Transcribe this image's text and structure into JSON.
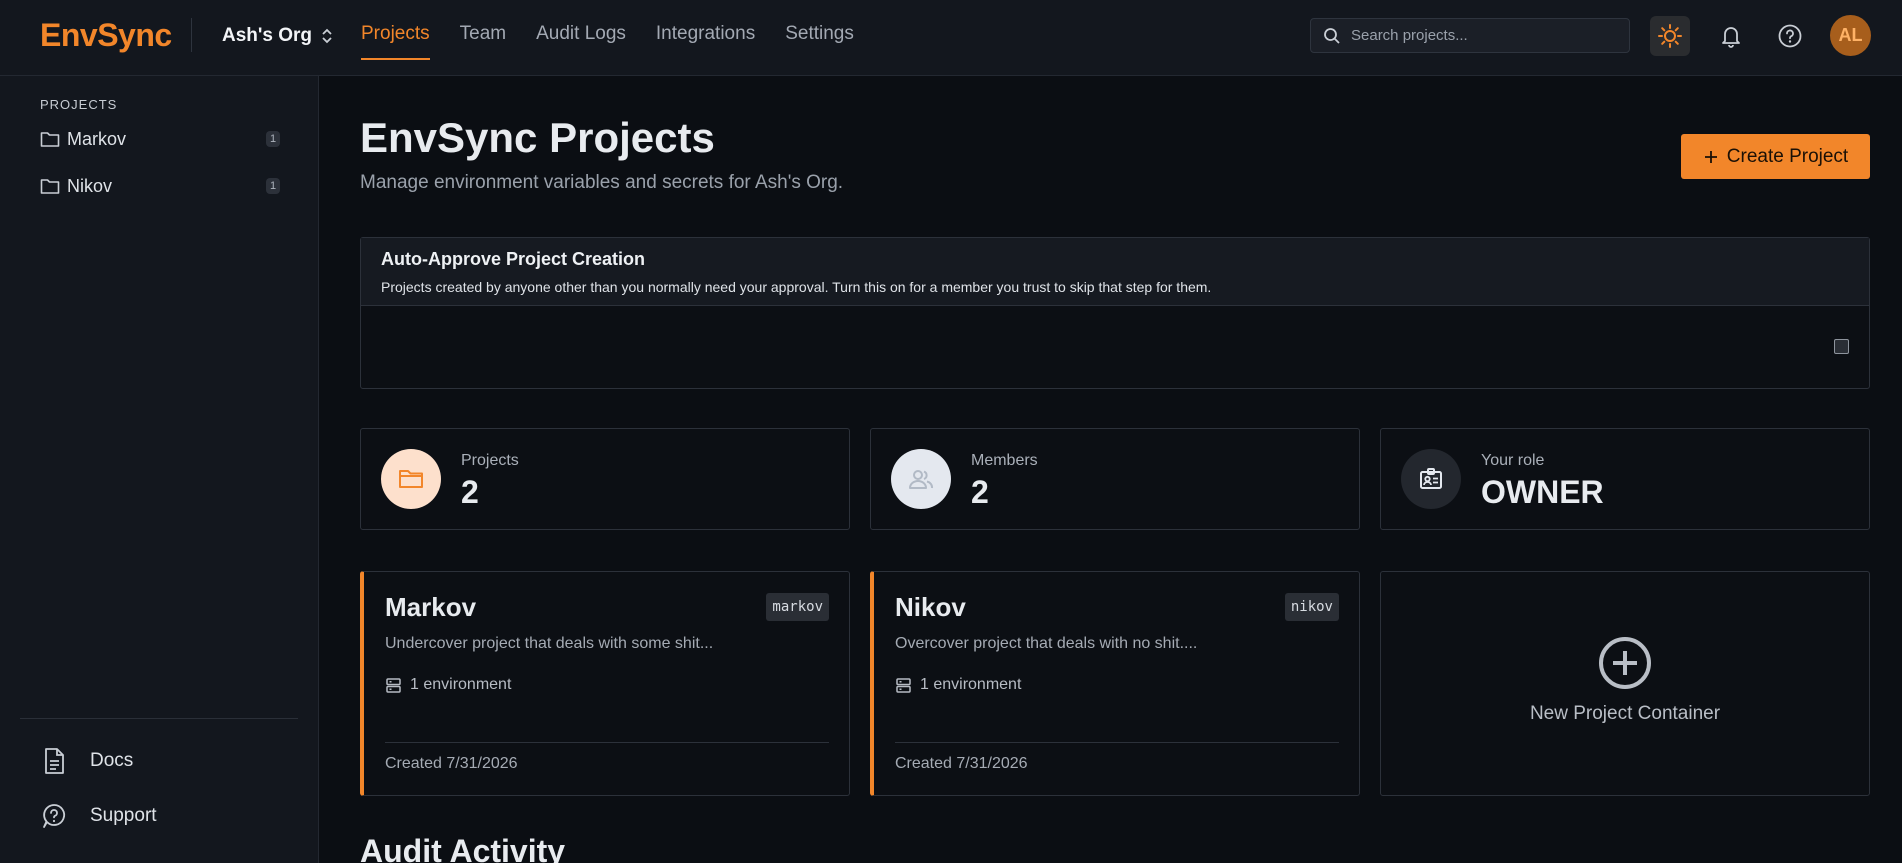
{
  "app": {
    "brand": "EnvSync",
    "org": "Ash's Org"
  },
  "nav": {
    "items": [
      {
        "label": "Projects",
        "active": true
      },
      {
        "label": "Team"
      },
      {
        "label": "Audit Logs"
      },
      {
        "label": "Integrations"
      },
      {
        "label": "Settings"
      }
    ]
  },
  "search": {
    "placeholder": "Search projects..."
  },
  "user": {
    "initials": "AL"
  },
  "sidebar": {
    "heading": "PROJECTS",
    "projects": [
      {
        "name": "Markov",
        "count": "1"
      },
      {
        "name": "Nikov",
        "count": "1"
      }
    ],
    "footer": [
      {
        "label": "Docs",
        "icon": "document-icon"
      },
      {
        "label": "Support",
        "icon": "support-icon"
      }
    ]
  },
  "page": {
    "title": "EnvSync Projects",
    "subtitle": "Manage environment variables and secrets for Ash's Org.",
    "create_label": "Create Project"
  },
  "auto_approve": {
    "title": "Auto-Approve Project Creation",
    "description": "Projects created by anyone other than you normally need your approval. Turn this on for a member you trust to skip that step for them.",
    "checked": false
  },
  "stats": [
    {
      "label": "Projects",
      "value": "2",
      "icon": "folder-icon"
    },
    {
      "label": "Members",
      "value": "2",
      "icon": "users-icon"
    },
    {
      "label": "Your role",
      "value": "OWNER",
      "icon": "id-badge-icon"
    }
  ],
  "projects": [
    {
      "name": "Markov",
      "slug": "markov",
      "description": "Undercover project that deals with some shit...",
      "environments": "1 environment",
      "created": "Created 7/31/2026"
    },
    {
      "name": "Nikov",
      "slug": "nikov",
      "description": "Overcover project that deals with no shit....",
      "environments": "1 environment",
      "created": "Created 7/31/2026"
    }
  ],
  "new_project_label": "New Project Container",
  "audit": {
    "title": "Audit Activity"
  },
  "colors": {
    "accent": "#f2862a",
    "background": "#0b0e13",
    "surface": "#13171e"
  }
}
